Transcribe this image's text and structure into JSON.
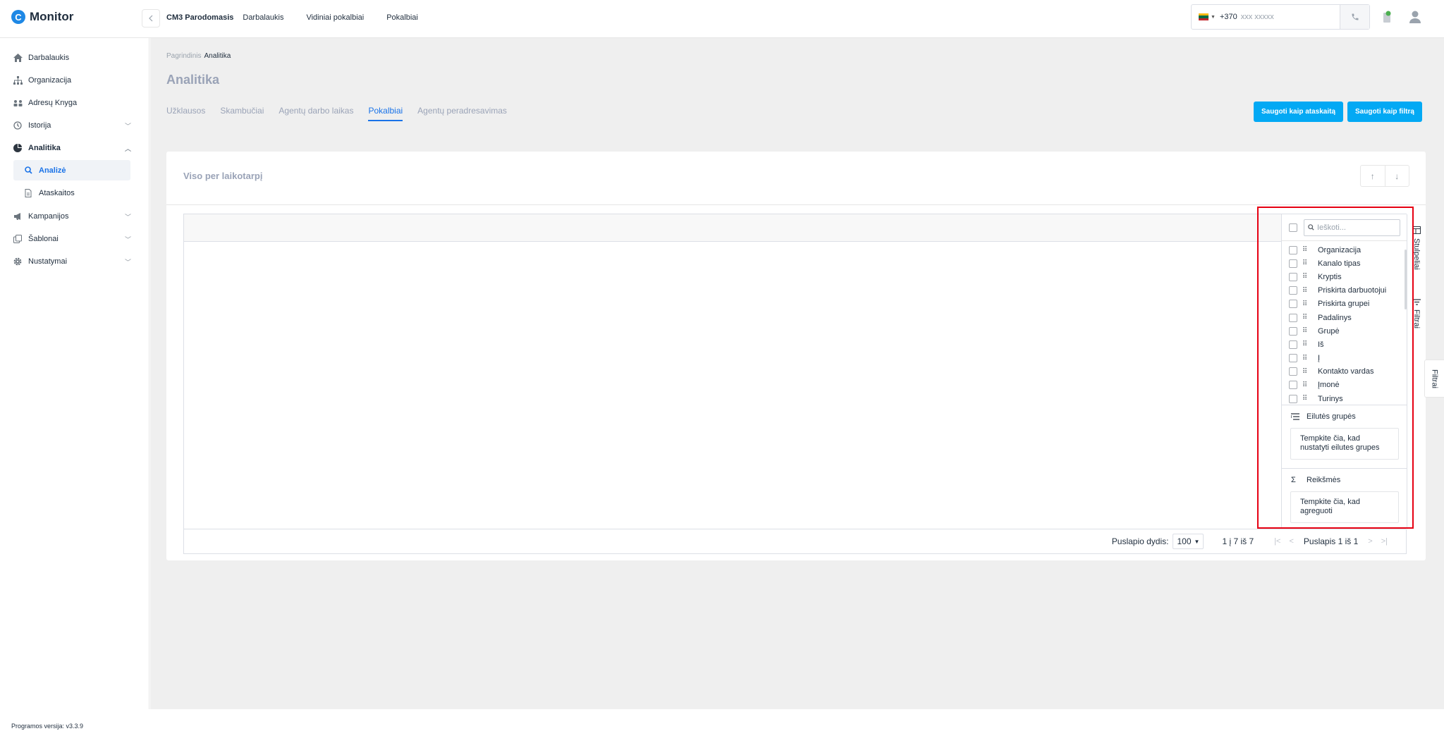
{
  "app": {
    "logo_text": "Monitor",
    "logo_letter": "C"
  },
  "header": {
    "company": "CM3 Parodomasis",
    "nav": [
      "Darbalaukis",
      "Vidiniai pokalbiai",
      "Pokalbiai"
    ],
    "phone_code": "+370",
    "phone_placeholder": "xxx xxxxx"
  },
  "sidebar": {
    "items": [
      {
        "label": "Darbalaukis",
        "icon": "home-icon"
      },
      {
        "label": "Organizacija",
        "icon": "org-icon"
      },
      {
        "label": "Adresų Knyga",
        "icon": "address-book-icon"
      },
      {
        "label": "Istorija",
        "icon": "history-icon",
        "chevron": "down"
      },
      {
        "label": "Analitika",
        "icon": "chart-icon",
        "chevron": "up",
        "expanded": true
      },
      {
        "label": "Kampanijos",
        "icon": "megaphone-icon",
        "chevron": "down"
      },
      {
        "label": "Šablonai",
        "icon": "template-icon",
        "chevron": "down"
      },
      {
        "label": "Nustatymai",
        "icon": "gear-icon",
        "chevron": "down"
      }
    ],
    "sub_items": [
      {
        "label": "Analizė",
        "icon": "search-icon",
        "active": true
      },
      {
        "label": "Ataskaitos",
        "icon": "document-icon",
        "active": false
      }
    ]
  },
  "breadcrumb": {
    "root": "Pagrindinis",
    "current": "Analitika"
  },
  "page": {
    "title": "Analitika",
    "tabs": [
      "Užklausos",
      "Skambučiai",
      "Agentų darbo laikas",
      "Pokalbiai",
      "Agentų peradresavimas"
    ],
    "active_tab": "Pokalbiai",
    "save_report_label": "Saugoti kaip ataskaitą",
    "save_filter_label": "Saugoti kaip filtrą"
  },
  "card": {
    "title": "Viso per laikotarpį"
  },
  "tool_panel": {
    "search_placeholder": "Ieškoti...",
    "columns": [
      "Organizacija",
      "Kanalo tipas",
      "Kryptis",
      "Priskirta darbuotojui",
      "Priskirta grupei",
      "Padalinys",
      "Grupė",
      "Iš",
      "Į",
      "Kontakto vardas",
      "Įmonė",
      "Turinys"
    ],
    "row_groups_title": "Eilutės grupės",
    "row_groups_drop": "Tempkite čia, kad nustatyti eilutes grupes",
    "values_title": "Reikšmės",
    "values_drop": "Tempkite čia, kad agreguoti",
    "tab_columns": "Stulpeliai",
    "tab_filters": "Filtrai"
  },
  "pagination": {
    "page_size_label": "Puslapio dydis:",
    "page_size": "100",
    "row_summary": "1 į 7 iš 7",
    "page_label": "Puslapis 1 iš 1"
  },
  "outer_filter_tab": "Filtrai",
  "footer": {
    "version": "Programos versija: v3.3.9"
  },
  "colors": {
    "accent": "#1a73e8",
    "button": "#03a9f4",
    "highlight": "#e60012",
    "success": "#4caf50"
  }
}
